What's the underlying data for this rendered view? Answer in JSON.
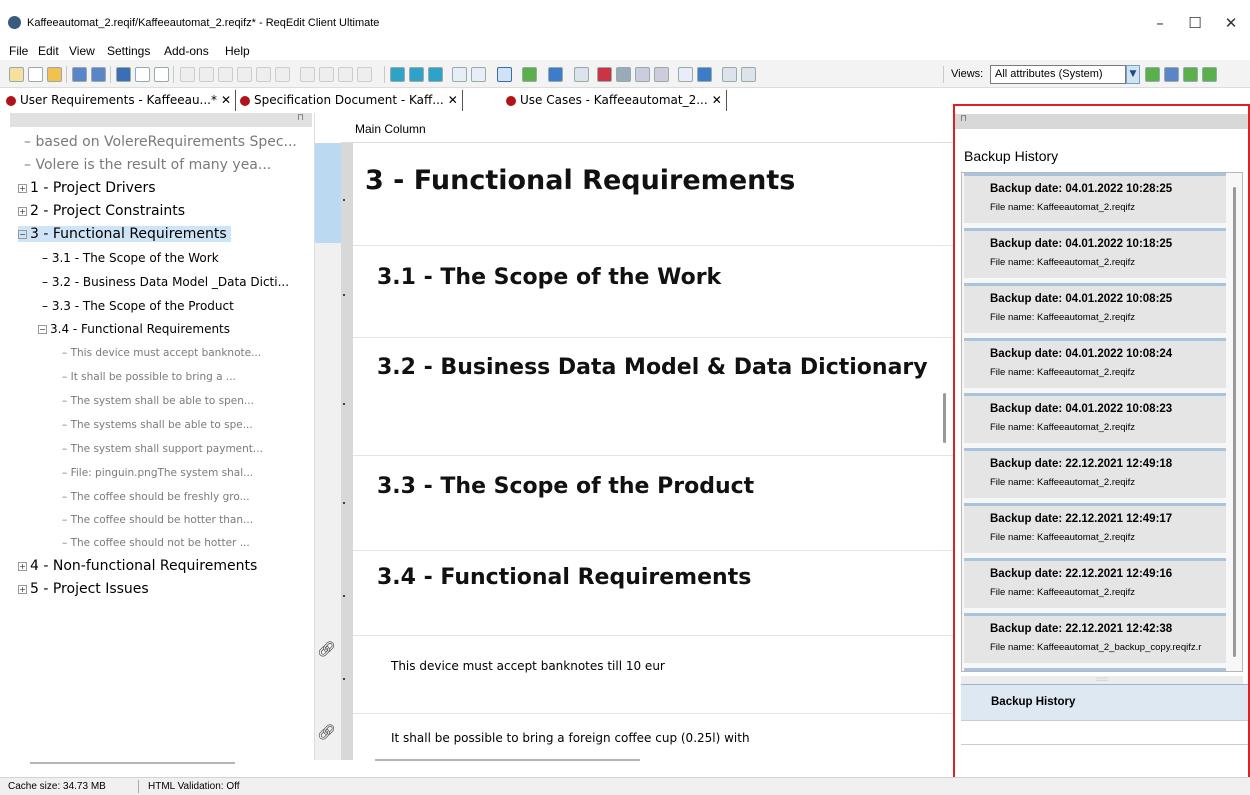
{
  "window": {
    "title": "Kaffeeautomat_2.reqif/Kaffeeautomat_2.reqifz* - ReqEdit Client Ultimate",
    "minimize": "–",
    "maximize": "☐",
    "close": "✕"
  },
  "menu": [
    "File",
    "Edit",
    "View",
    "Settings",
    "Add-ons",
    "Help"
  ],
  "toolbar": {
    "views_label": "Views:",
    "views_value": "All attributes (System)"
  },
  "tabs": [
    {
      "label": "User Requirements - Kaffeeau...*",
      "close": "✕"
    },
    {
      "label": "Specification Document - Kaff...",
      "close": "✕"
    },
    {
      "label": "Use Cases - Kaffeeautomat_2...",
      "close": "✕"
    }
  ],
  "tree": {
    "items": [
      {
        "label": "based on VolereRequirements Spec..."
      },
      {
        "label": "Volere is the result of many yea..."
      },
      {
        "label": "1 - Project Drivers",
        "expander": "+"
      },
      {
        "label": "2 - Project Constraints",
        "expander": "+"
      },
      {
        "label": "3 - Functional Requirements",
        "expander": "−"
      },
      {
        "label": "3.1 - The Scope of the Work"
      },
      {
        "label": "3.2 - Business Data Model _Data Dicti..."
      },
      {
        "label": "3.3 - The Scope of the Product"
      },
      {
        "label": "3.4 - Functional Requirements",
        "expander": "−"
      },
      {
        "label": "This device must accept banknote..."
      },
      {
        "label": "It shall be possible to bring a ..."
      },
      {
        "label": "The system shall be able to spen..."
      },
      {
        "label": "The systems shall be able to spe..."
      },
      {
        "label": "The system shall support payment..."
      },
      {
        "label": "File: pinguin.pngThe system shal..."
      },
      {
        "label": "The coffee should be freshly gro..."
      },
      {
        "label": "The coffee should be hotter than..."
      },
      {
        "label": "The coffee should not be hotter ..."
      },
      {
        "label": "4 - Non-functional Requirements",
        "expander": "+"
      },
      {
        "label": "5 - Project Issues",
        "expander": "+"
      }
    ]
  },
  "editor": {
    "column_header": "Main Column",
    "rows": [
      {
        "text": "3 - Functional Requirements"
      },
      {
        "text": "3.1 - The Scope of the Work"
      },
      {
        "text": "3.2 - Business Data Model & Data Dictionary"
      },
      {
        "text": "3.3 - The Scope of the Product"
      },
      {
        "text": "3.4 - Functional Requirements"
      },
      {
        "text": "This device must accept banknotes till 10 eur"
      },
      {
        "text": "It shall be possible to bring a foreign coffee cup (0.25l) with"
      }
    ]
  },
  "backup_history": {
    "title": "Backup History",
    "entries": [
      {
        "date": "Backup date: 04.01.2022 10:28:25",
        "file": "File name: Kaffeeautomat_2.reqifz"
      },
      {
        "date": "Backup date: 04.01.2022 10:18:25",
        "file": "File name: Kaffeeautomat_2.reqifz"
      },
      {
        "date": "Backup date: 04.01.2022 10:08:25",
        "file": "File name: Kaffeeautomat_2.reqifz"
      },
      {
        "date": "Backup date: 04.01.2022 10:08:24",
        "file": "File name: Kaffeeautomat_2.reqifz"
      },
      {
        "date": "Backup date: 04.01.2022 10:08:23",
        "file": "File name: Kaffeeautomat_2.reqifz"
      },
      {
        "date": "Backup date: 22.12.2021 12:49:18",
        "file": "File name: Kaffeeautomat_2.reqifz"
      },
      {
        "date": "Backup date: 22.12.2021 12:49:17",
        "file": "File name: Kaffeeautomat_2.reqifz"
      },
      {
        "date": "Backup date: 22.12.2021 12:49:16",
        "file": "File name: Kaffeeautomat_2.reqifz"
      },
      {
        "date": "Backup date: 22.12.2021 12:42:38",
        "file": "File name: Kaffeeautomat_2_backup_copy.reqifz.r"
      }
    ],
    "grip": "::::::",
    "tab_label": "Backup History"
  },
  "status": {
    "cache": "Cache size: 34.73 MB",
    "validation": "HTML Validation: Off"
  },
  "colors": {
    "accent_red": "#e02020",
    "selection_blue": "#cfe5f7",
    "tab_dot": "#b0141b"
  }
}
